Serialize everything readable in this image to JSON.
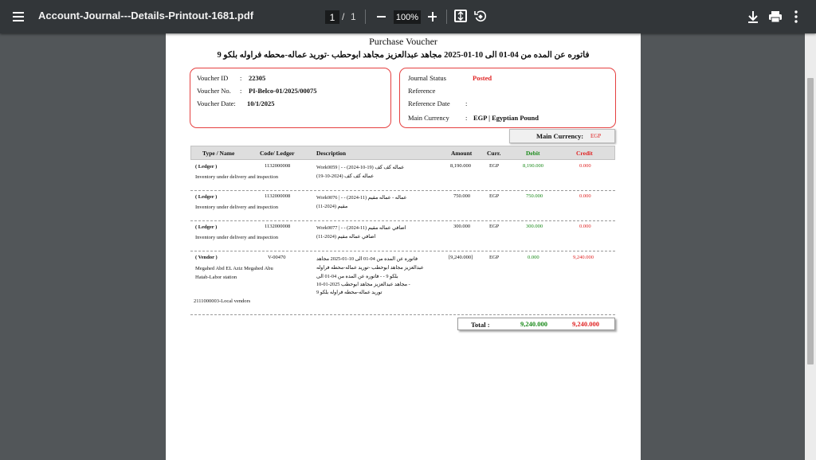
{
  "viewer": {
    "filename": "Account-Journal---Details-Printout-1681.pdf",
    "page_current": "1",
    "page_sep": "/",
    "page_total": "1",
    "zoom": "100%",
    "icons": [
      "menu-icon",
      "zoom-out-icon",
      "zoom-in-icon",
      "fit-page-icon",
      "rotate-icon",
      "download-icon",
      "print-icon",
      "more-icon"
    ]
  },
  "doc": {
    "title": "Purchase Voucher",
    "subtitle": "فاتوره عن المده من 04-01 الى 10-01-2025 مجاهد عبدالعزيز مجاهد ابوحطب -توريد عماله-محطه فراوله بلكو 9",
    "left_box": {
      "voucher_id_label": "Voucher ID",
      "voucher_id": "22305",
      "voucher_no_label": "Voucher No.",
      "voucher_no": "PI-Belco-01/2025/00075",
      "voucher_date_label": "Voucher Date:",
      "voucher_date": "10/1/2025",
      "colon": ":"
    },
    "right_box": {
      "journal_status_label": "Journal Status",
      "journal_status": "Posted",
      "reference_label": "Reference",
      "reference_date_label": "Reference Date",
      "main_currency_label": "Main Currency",
      "main_currency": "EGP | Egyptian Pound",
      "colon": ":"
    },
    "main_currency_box": {
      "label": "Main Currency:",
      "value": "EGP"
    },
    "columns": {
      "type": "Type / Name",
      "code": "Code/ Ledger",
      "description": "Description",
      "amount": "Amount",
      "curr": "Curr.",
      "debit": "Debit",
      "credit": "Credit"
    },
    "rows": [
      {
        "type": "( Ledger )",
        "name": "Inventory under delivery and inspection",
        "code": "1132000008",
        "desc": [
          "Work0059 | - - (2024-10-19) عماله كف كف",
          "(عماله كف كف (2024-10-19"
        ],
        "amount": "8,190.000",
        "curr": "EGP",
        "debit": "8,190.000",
        "credit": "0.000"
      },
      {
        "type": "( Ledger )",
        "name": "Inventory under delivery and inspection",
        "code": "1132000008",
        "desc": [
          "Work0076 | - - (2024-11) عماله - عماله مقيم",
          "(مقيم (2024-11"
        ],
        "amount": "750.000",
        "curr": "EGP",
        "debit": "750.000",
        "credit": "0.000"
      },
      {
        "type": "( Ledger )",
        "name": "Inventory under delivery and inspection",
        "code": "1132000008",
        "desc": [
          "Work0077 | - - (2024-11) اضافي عماله مقيم",
          "(اضافي عماله مقيم (2024-11"
        ],
        "amount": "300.000",
        "curr": "EGP",
        "debit": "300.000",
        "credit": "0.000"
      },
      {
        "type": "( Vendor )",
        "name_1": "Megahed Abd EL Aziz Megahed Abu",
        "name_2": "Hatab-Labor station",
        "account": "2111000003-Local vendors",
        "code": "V-00470",
        "desc": [
          "فاتوره عن المده من 04-01 الى 10-01-2025 مجاهد",
          "عبدالعزيز مجاهد ابوحطب -توريد عماله-محطه فراوله",
          "بلكو 9 - - فاتوره عن المده من 04-01 الى",
          "10-01-2025 مجاهد عبدالعزيز مجاهد ابوحطب -",
          "توريد عماله-محطه فراوله بلكو 9"
        ],
        "amount": "[9,240.000]",
        "curr": "EGP",
        "debit": "0.000",
        "credit": "9,240.000"
      }
    ],
    "total": {
      "label": "Total :",
      "debit": "9,240.000",
      "credit": "9,240.000"
    }
  }
}
